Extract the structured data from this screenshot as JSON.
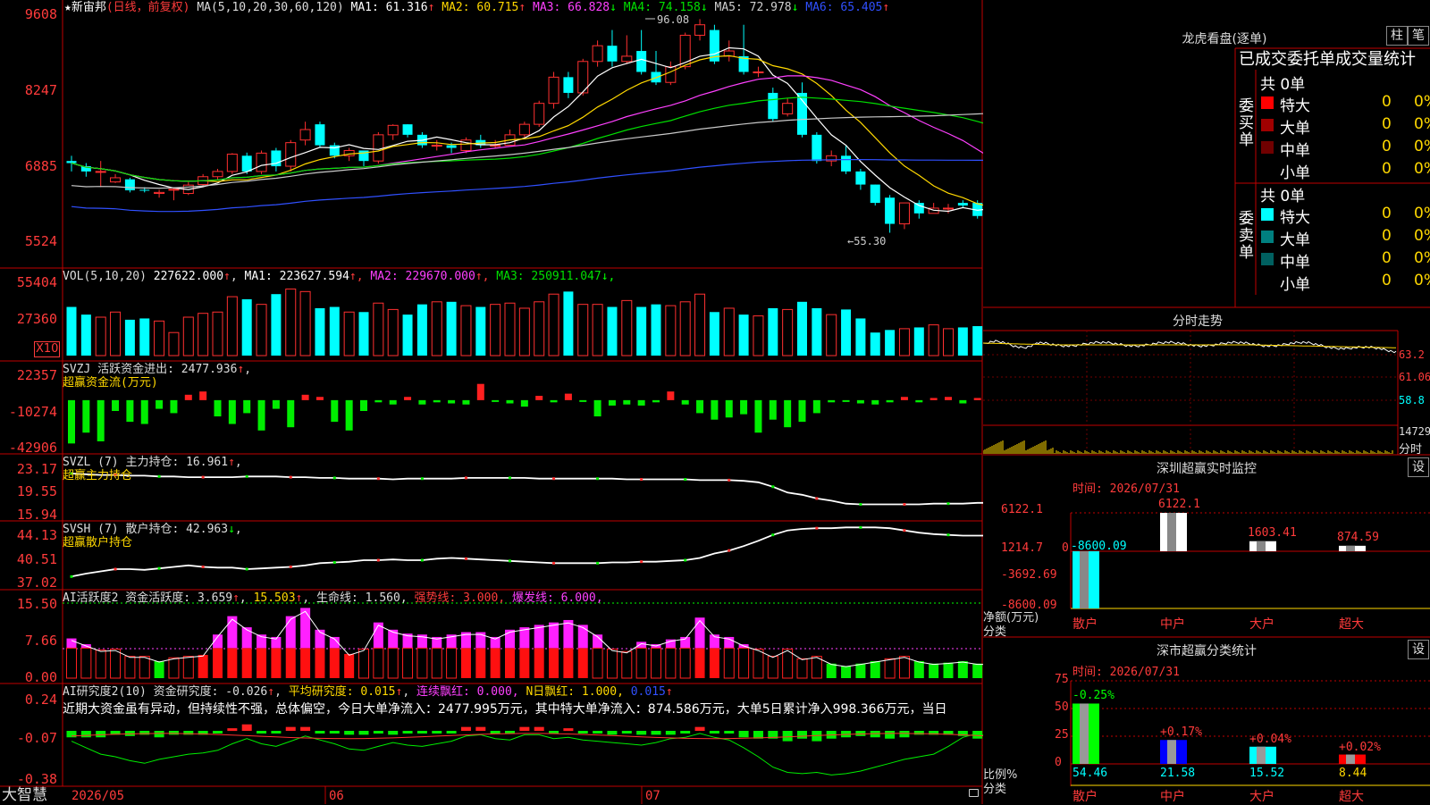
{
  "stock": {
    "name": "新宙邦",
    "period": "(日线，前复权)",
    "ma_label": "MA(5,10,20,30,60,120)",
    "ma_values": [
      {
        "label": "MA1:",
        "value": "61.316",
        "arrow": "↑",
        "color": "#ffffff"
      },
      {
        "label": "MA2:",
        "value": "60.715",
        "arrow": "↑",
        "color": "#ffd800"
      },
      {
        "label": "MA3:",
        "value": "66.828",
        "arrow": "↓",
        "color": "#ff40ff"
      },
      {
        "label": "MA4:",
        "value": "74.158",
        "arrow": "↓",
        "color": "#00e000"
      },
      {
        "label": "MA5:",
        "value": "72.978",
        "arrow": "↓",
        "color": "#d0d0d0"
      },
      {
        "label": "MA6:",
        "value": "65.405",
        "arrow": "↑",
        "color": "#3050ff"
      }
    ],
    "y_ticks": [
      "9608",
      "8247",
      "6885",
      "5524"
    ],
    "high_marker": "96.08",
    "low_marker": "55.30"
  },
  "chart_data": [
    {
      "type": "candlestick",
      "name": "price",
      "ylim": [
        53,
        97
      ],
      "candles": [
        [
          69,
          68.6,
          67,
          70
        ],
        [
          68,
          67,
          66,
          68.6
        ],
        [
          67,
          67,
          64,
          69
        ],
        [
          65,
          65.8,
          64.8,
          66.5
        ],
        [
          65.5,
          63.4,
          63,
          65.8
        ],
        [
          63.5,
          63.4,
          63,
          64
        ],
        [
          62.8,
          63,
          62,
          63.5
        ],
        [
          63.5,
          63.6,
          61.5,
          64
        ],
        [
          62.8,
          64.4,
          62.5,
          65
        ],
        [
          64.5,
          66,
          64,
          66.5
        ],
        [
          66,
          67,
          65.5,
          67.5
        ],
        [
          67,
          70.3,
          66.5,
          70.5
        ],
        [
          70,
          67,
          66.5,
          70.6
        ],
        [
          67,
          70.5,
          66.5,
          71
        ],
        [
          71,
          68,
          67,
          71.5
        ],
        [
          68,
          72.5,
          67,
          73
        ],
        [
          73,
          75,
          72,
          76.5
        ],
        [
          76,
          72,
          71.5,
          76.5
        ],
        [
          72,
          70,
          69.5,
          72.5
        ],
        [
          70,
          71,
          69,
          71.5
        ],
        [
          71,
          69,
          68,
          71
        ],
        [
          69,
          74,
          68.5,
          74.5
        ],
        [
          74,
          75.8,
          73,
          76
        ],
        [
          76,
          74,
          73.5,
          76
        ],
        [
          74,
          72,
          71.5,
          74.5
        ],
        [
          72,
          72,
          71,
          73
        ],
        [
          72,
          71.5,
          70.5,
          72.5
        ],
        [
          71,
          73,
          70.5,
          73.5
        ],
        [
          73,
          72,
          71.5,
          74
        ],
        [
          72,
          72,
          71.5,
          73
        ],
        [
          72,
          74,
          72,
          75
        ],
        [
          74,
          76,
          73.5,
          76.5
        ],
        [
          76,
          80,
          75.5,
          80.5
        ],
        [
          80,
          85,
          79,
          86
        ],
        [
          85,
          82,
          81,
          86
        ],
        [
          82,
          88,
          81.5,
          88.5
        ],
        [
          88,
          91,
          87,
          92
        ],
        [
          91,
          88,
          87,
          94
        ],
        [
          88,
          89,
          87.5,
          93
        ],
        [
          90,
          86,
          85.5,
          94
        ],
        [
          86,
          84,
          83.5,
          90
        ],
        [
          84,
          87,
          83.5,
          88
        ],
        [
          87,
          93,
          86.5,
          93.5
        ],
        [
          93,
          95,
          92,
          96.08
        ],
        [
          94,
          88,
          87.5,
          95
        ],
        [
          89,
          90,
          88,
          92
        ],
        [
          89,
          86,
          85.5,
          95
        ],
        [
          86,
          86,
          85,
          87
        ],
        [
          82,
          77,
          76.5,
          83
        ],
        [
          78,
          80,
          77.5,
          81
        ],
        [
          82,
          74,
          73.5,
          84
        ],
        [
          74,
          69,
          68.5,
          74.5
        ],
        [
          69,
          70,
          68,
          71
        ],
        [
          70,
          67,
          66.5,
          72
        ],
        [
          67,
          64.5,
          63.5,
          67.5
        ],
        [
          64.5,
          61,
          60.5,
          64.5
        ],
        [
          62,
          57,
          55.3,
          62.5
        ],
        [
          57,
          61,
          56,
          61
        ],
        [
          61,
          59,
          58,
          61.5
        ],
        [
          59,
          60,
          59,
          61
        ],
        [
          60,
          60,
          59,
          60.8
        ],
        [
          61,
          60.5,
          60,
          61.5
        ],
        [
          61,
          58.5,
          58,
          61.5
        ],
        [
          58,
          60.5,
          56.5,
          61
        ],
        [
          60.5,
          60,
          59.5,
          61
        ],
        [
          60,
          62,
          59.5,
          62.5
        ]
      ]
    },
    {
      "type": "bar",
      "name": "VOL(5,10,20)",
      "ylim": [
        0,
        60000
      ],
      "values": [
        38000,
        32000,
        30000,
        34000,
        28000,
        29000,
        27000,
        18000,
        30000,
        33000,
        34000,
        46000,
        44000,
        40000,
        48000,
        52000,
        50000,
        37000,
        38000,
        34000,
        34000,
        41000,
        36000,
        32000,
        40000,
        42000,
        42000,
        39000,
        38000,
        40000,
        41000,
        37000,
        42000,
        48000,
        50000,
        40000,
        40000,
        38000,
        43000,
        38000,
        40000,
        39000,
        42000,
        48000,
        34000,
        37000,
        32000,
        31000,
        37000,
        36000,
        42000,
        37000,
        32000,
        36000,
        29000,
        18000,
        20000,
        21000,
        22000,
        24000,
        21000,
        22000,
        23000,
        18000,
        24000,
        20000
      ]
    },
    {
      "type": "bar",
      "name": "SVZJ",
      "ylim": [
        -43000,
        23000
      ],
      "values": [
        -40000,
        -30000,
        -38000,
        -10000,
        -20000,
        -22000,
        -8000,
        -12000,
        5000,
        8000,
        -15000,
        -22000,
        -12000,
        -28000,
        -8000,
        -25000,
        5000,
        3000,
        -20000,
        -28000,
        -10000,
        -2000,
        -4000,
        3000,
        -4000,
        -2000,
        -3000,
        -4000,
        15000,
        -1000,
        -3000,
        -6000,
        4000,
        -2000,
        6000,
        -1000,
        -15000,
        -5000,
        -4000,
        -5000,
        -2000,
        8000,
        -4000,
        -12000,
        -18000,
        -16000,
        -13000,
        -30000,
        -18000,
        -25000,
        -20000,
        -12000,
        -2000,
        -1000,
        -3000,
        -4000,
        -2000,
        3000,
        -2000,
        2000,
        3000,
        -3000,
        2000,
        2000,
        2000,
        -1000
      ]
    },
    {
      "type": "line",
      "name": "SVZL",
      "ylim": [
        15.9,
        23.2
      ],
      "values": [
        21.5,
        21.4,
        21.3,
        21.3,
        21.2,
        21.2,
        21.1,
        21.1,
        21.0,
        21.0,
        21.0,
        21.0,
        21.1,
        21.1,
        21.1,
        21.0,
        21.0,
        20.9,
        20.9,
        20.8,
        20.8,
        20.8,
        20.7,
        20.8,
        20.8,
        20.8,
        20.8,
        20.9,
        20.9,
        20.9,
        20.9,
        20.9,
        20.8,
        20.8,
        20.8,
        20.8,
        20.8,
        20.8,
        20.7,
        20.7,
        20.7,
        20.7,
        20.7,
        20.6,
        20.6,
        20.6,
        20.5,
        20.3,
        19.7,
        18.9,
        18.6,
        18.1,
        17.8,
        17.4,
        17.3,
        17.3,
        17.3,
        17.3,
        17.3,
        17.4,
        17.4,
        17.4,
        17.5,
        17.5,
        17.6,
        17.6
      ]
    },
    {
      "type": "line",
      "name": "SVSH",
      "ylim": [
        37.0,
        44.2
      ],
      "values": [
        37.8,
        38.2,
        38.5,
        38.8,
        38.8,
        38.7,
        38.9,
        39.1,
        39.3,
        39.1,
        39.0,
        39.0,
        38.8,
        38.9,
        39.0,
        39.1,
        39.3,
        39.6,
        39.7,
        39.8,
        40.0,
        40.0,
        40.1,
        40.0,
        40.0,
        40.2,
        40.3,
        40.2,
        40.1,
        40.0,
        39.9,
        39.8,
        39.7,
        39.6,
        39.6,
        39.6,
        39.6,
        39.7,
        39.7,
        39.8,
        39.8,
        39.9,
        40.0,
        40.3,
        40.9,
        41.3,
        41.9,
        42.6,
        43.4,
        44.0,
        44.2,
        44.3,
        44.3,
        44.4,
        44.4,
        44.4,
        44.3,
        44.0,
        43.7,
        43.5,
        43.4,
        43.3,
        43.3,
        43.3,
        43.3,
        43.0
      ]
    },
    {
      "type": "bar",
      "name": "AI活跃度2",
      "ylim": [
        0,
        15.5
      ],
      "values": [
        8.2,
        7.0,
        5.8,
        6.0,
        4.5,
        4.5,
        3.5,
        4.2,
        4.5,
        4.8,
        9.0,
        12.8,
        10.5,
        9.0,
        8.5,
        12.8,
        14.5,
        10.0,
        8.5,
        5.0,
        6.0,
        11.5,
        10.0,
        9.2,
        9.0,
        8.5,
        9.0,
        9.5,
        9.5,
        8.5,
        10.0,
        10.5,
        11.0,
        11.5,
        12.0,
        11.0,
        9.0,
        6.0,
        5.5,
        7.5,
        7.0,
        8.0,
        8.5,
        12.5,
        9.0,
        8.5,
        7.0,
        6.0,
        4.5,
        6.0,
        4.0,
        4.5,
        3.0,
        2.5,
        3.0,
        3.5,
        4.0,
        4.5,
        3.5,
        3.0,
        3.2,
        3.5,
        3.0,
        3.0,
        3.2,
        3.0
      ]
    },
    {
      "type": "bar",
      "name": "AI研究度2",
      "ylim": [
        -0.38,
        0.24
      ],
      "values": [
        -0.05,
        -0.05,
        -0.05,
        -0.03,
        -0.04,
        -0.03,
        -0.05,
        -0.03,
        -0.03,
        -0.03,
        -0.02,
        0.02,
        0.05,
        -0.01,
        -0.01,
        0.03,
        0.03,
        -0.01,
        -0.02,
        -0.03,
        -0.03,
        -0.02,
        -0.03,
        -0.01,
        -0.02,
        -0.01,
        -0.02,
        0.03,
        0.03,
        -0.01,
        -0.02,
        0.03,
        0.03,
        -0.02,
        0.02,
        -0.02,
        -0.02,
        -0.03,
        -0.02,
        -0.03,
        -0.03,
        -0.03,
        -0.02,
        0.03,
        -0.02,
        -0.02,
        -0.05,
        -0.06,
        -0.06,
        -0.08,
        -0.06,
        -0.08,
        -0.06,
        -0.05,
        -0.04,
        -0.05,
        -0.06,
        -0.05,
        -0.03,
        -0.03,
        -0.03,
        -0.04,
        -0.06,
        -0.05,
        -0.04,
        -0.03
      ]
    }
  ],
  "vol": {
    "header": "VOL(5,10,20)",
    "value": "227622.000",
    "items": [
      {
        "label": "MA1:",
        "value": "223627.594",
        "arrow": "↑",
        "color": "#ffffff"
      },
      {
        "label": "MA2:",
        "value": "229670.000",
        "arrow": "↑",
        "color": "#ff40ff"
      },
      {
        "label": "MA3:",
        "value": "250911.047",
        "arrow": "↓",
        "color": "#00e000"
      }
    ],
    "y_ticks": [
      "55404",
      "27360"
    ],
    "unit": "X10"
  },
  "svzj": {
    "header": "SVZJ  活跃资金进出: 2477.936",
    "sub": "超赢资金流(万元)",
    "y_ticks": [
      "22357",
      "-10274",
      "-42906"
    ]
  },
  "svzl": {
    "header": "SVZL (7) 主力持仓: 16.961",
    "sub": "超赢主力持仓",
    "y_ticks": [
      "23.17",
      "19.55",
      "15.94"
    ]
  },
  "svsh": {
    "header": "SVSH (7) 散户持仓: 42.963",
    "sub": "超赢散户持仓",
    "y_ticks": [
      "44.13",
      "40.51",
      "37.02"
    ]
  },
  "ai1": {
    "header": "AI活跃度2 资金活跃度: 3.659",
    "v2": "15.503",
    "v3": "生命线: 1.560,",
    "v4": "强势线: 3.000,",
    "v5": "爆发线: 6.000,",
    "y_ticks": [
      "15.50",
      "7.66",
      "0.00"
    ]
  },
  "ai2": {
    "header": "AI研究度2(10) 资金研究度: -0.026",
    "v2": "平均研究度: 0.015",
    "v3": "连续飘红: 0.000,",
    "v4": "N日飘红: 1.000,",
    "v5": "0.015",
    "text": "近期大资金虽有异动，但持续性不强，总体偏空，今日大单净流入：2477.995万元，其中特大单净流入：874.586万元，大单5日累计净入998.366万元，当日",
    "y_ticks": [
      "0.24",
      "-0.07",
      "-0.38"
    ]
  },
  "bottom": {
    "brand": "大智慧",
    "dates": [
      "2026/05",
      "06",
      "07"
    ]
  },
  "right": {
    "title": "龙虎看盘(逐单)",
    "btn_zhu": "柱",
    "btn_bi": "笔",
    "stats_header": "已成交委托单成交量统计",
    "buy_side": "委买单",
    "sell_side": "委卖单",
    "buy_total": "共 0单",
    "sell_total": "共 0单",
    "buy_rows": [
      {
        "label": "特大",
        "n": "0",
        "pct": "0%",
        "color": "#ff0000"
      },
      {
        "label": "大单",
        "n": "0",
        "pct": "0%",
        "color": "#a00000"
      },
      {
        "label": "中单",
        "n": "0",
        "pct": "0%",
        "color": "#700000"
      },
      {
        "label": "小单",
        "n": "0",
        "pct": "0%",
        "color": "#000000"
      }
    ],
    "sell_rows": [
      {
        "label": "特大",
        "n": "0",
        "pct": "0%",
        "color": "#00ffff"
      },
      {
        "label": "大单",
        "n": "0",
        "pct": "0%",
        "color": "#008080"
      },
      {
        "label": "中单",
        "n": "0",
        "pct": "0%",
        "color": "#006060"
      },
      {
        "label": "小单",
        "n": "0",
        "pct": "0%",
        "color": "#000000"
      }
    ],
    "intraday_title": "分时走势",
    "intraday_ticks": [
      "63.2",
      "61.06",
      "58.8",
      "14729",
      "分时"
    ],
    "sz_title": "深圳超赢实时监控",
    "sz_btn": "设",
    "sz_time": "时间: 2026/07/31",
    "sz_yticks": [
      "6122.1",
      "1214.7",
      "0",
      "-3692.69",
      "-8600.09"
    ],
    "sz_ylabel1": "净额(万元)",
    "sz_ylabel2": "分类",
    "sz_bars": [
      {
        "cat": "散户",
        "value": -8600.09,
        "label": "-8600.09",
        "color": "#00ffff"
      },
      {
        "cat": "中户",
        "value": 6122.1,
        "label": "6122.1",
        "color": "#ffffff"
      },
      {
        "cat": "大户",
        "value": 1603.41,
        "label": "1603.41",
        "color": "#ffffff"
      },
      {
        "cat": "超大",
        "value": 874.59,
        "label": "874.59",
        "color": "#ffffff"
      }
    ],
    "sh_title": "深市超赢分类统计",
    "sh_btn": "设",
    "sh_time": "时间: 2026/07/31",
    "sh_yticks": [
      "75",
      "50",
      "25",
      "0"
    ],
    "sh_ylabel1": "比例%",
    "sh_ylabel2": "分类",
    "sh_bars": [
      {
        "cat": "散户",
        "value": 54.46,
        "label": "54.46",
        "delta": "-0.25%",
        "color": "#00ff00"
      },
      {
        "cat": "中户",
        "value": 21.58,
        "label": "21.58",
        "delta": "+0.17%",
        "color": "#0000ff"
      },
      {
        "cat": "大户",
        "value": 15.52,
        "label": "15.52",
        "delta": "+0.04%",
        "color": "#00ffff"
      },
      {
        "cat": "超大",
        "value": 8.44,
        "label": "8.44",
        "delta": "+0.02%",
        "color": "#ff0000"
      }
    ]
  }
}
